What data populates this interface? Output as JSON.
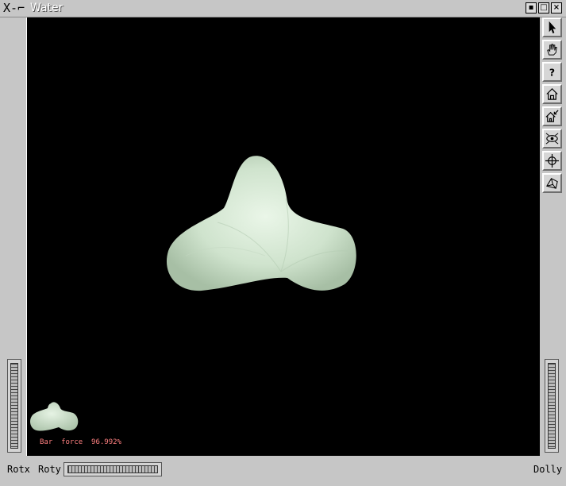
{
  "window": {
    "title": "Water",
    "logo": "X-⌐",
    "controls": {
      "iconify": "▪",
      "maximize": "□",
      "close": "×"
    }
  },
  "toolbar": {
    "buttons": [
      {
        "name": "pick-arrow-icon",
        "glyph": "↖"
      },
      {
        "name": "hand-icon",
        "glyph": "✋"
      },
      {
        "name": "help-icon",
        "glyph": "?"
      },
      {
        "name": "home-icon",
        "glyph": "⌂"
      },
      {
        "name": "set-home-icon",
        "glyph": "⌂"
      },
      {
        "name": "view-all-icon",
        "glyph": "◉"
      },
      {
        "name": "seek-icon",
        "glyph": "✜"
      },
      {
        "name": "projection-icon",
        "glyph": "◇"
      }
    ]
  },
  "bottom": {
    "rotx_label": "Rotx",
    "roty_label": "Roty",
    "dolly_label": "Dolly"
  },
  "overlay": {
    "status_text": "Bar  force  96.992%"
  },
  "colors": {
    "viewport_bg": "#000000",
    "shape_fill": "#d9ecd8",
    "overlay_text": "#ff8080",
    "chrome": "#c6c6c6"
  }
}
